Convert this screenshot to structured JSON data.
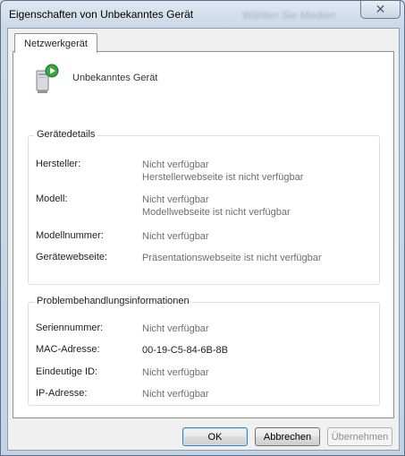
{
  "window": {
    "title": "Eigenschaften von Unbekanntes Gerät",
    "background_text": "Wählen Sie Medien"
  },
  "tab": {
    "label": "Netzwerkgerät"
  },
  "device": {
    "name": "Unbekanntes Gerät",
    "icon": "network-device-icon"
  },
  "details": {
    "title": "Gerätedetails",
    "manufacturer_label": "Hersteller:",
    "manufacturer_value": "Nicht verfügbar",
    "manufacturer_site": "Herstellerwebseite ist nicht verfügbar",
    "model_label": "Modell:",
    "model_value": "Nicht verfügbar",
    "model_site": "Modellwebseite ist nicht verfügbar",
    "model_number_label": "Modellnummer:",
    "model_number_value": "Nicht verfügbar",
    "device_site_label": "Gerätewebseite:",
    "device_site_value": "Präsentationswebseite ist nicht verfügbar"
  },
  "troubleshooting": {
    "title": "Problembehandlungsinformationen",
    "serial_label": "Seriennummer:",
    "serial_value": "Nicht verfügbar",
    "mac_label": "MAC-Adresse:",
    "mac_value": "00-19-C5-84-6B-8B",
    "uid_label": "Eindeutige ID:",
    "uid_value": "Nicht verfügbar",
    "ip_label": "IP-Adresse:",
    "ip_value": "Nicht verfügbar"
  },
  "buttons": {
    "ok": "OK",
    "cancel": "Abbrechen",
    "apply": "Übernehmen"
  }
}
